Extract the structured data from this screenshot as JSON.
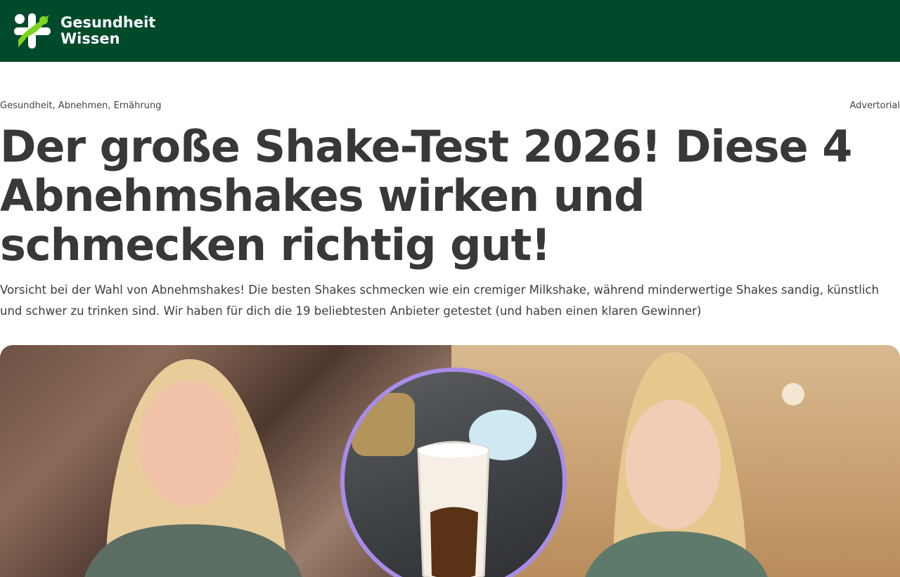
{
  "brand": {
    "name_line1": "Gesundheit",
    "name_line2": "Wissen",
    "colors": {
      "header_bg": "#004a2c",
      "logo_green": "#7ed321",
      "logo_white": "#ffffff",
      "circle_border": "#a98ce8"
    }
  },
  "meta": {
    "categories": [
      "Gesundheit",
      "Abnehmen",
      "Ernährung"
    ],
    "separator": ", ",
    "label": "Advertorial"
  },
  "article": {
    "headline": "Der große Shake-Test 2026! Diese 4 Abnehmshakes wirken und schmecken richtig gut!",
    "lead": "Vorsicht bei der Wahl von Abnehmshakes! Die besten Shakes schmecken wie ein cremiger Milkshake, während minderwertige Shakes sandig, künstlich und schwer zu trinken sind. Wir haben für dich die 19 beliebtesten Anbieter getestet (und haben einen klaren Gewinner)"
  },
  "hero": {
    "left_image": "woman-before-photo",
    "center_image": "shake-glass-photo",
    "right_image": "woman-after-photo"
  }
}
